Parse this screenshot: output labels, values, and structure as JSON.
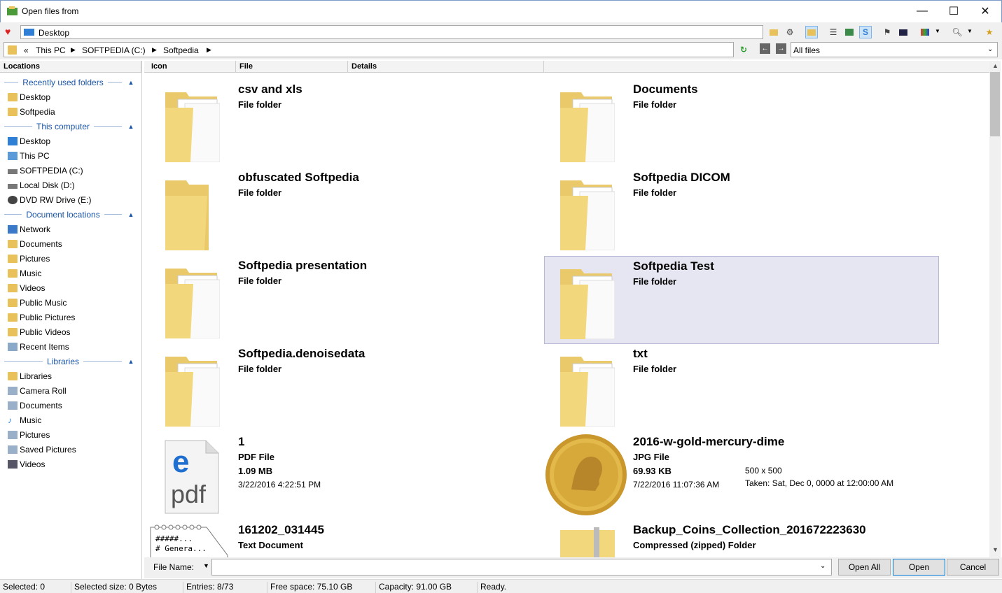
{
  "window": {
    "title": "Open files from",
    "minimize": "—",
    "maximize": "☐",
    "close": "✕"
  },
  "address": {
    "value": "Desktop"
  },
  "breadcrumb": {
    "prefix": "«",
    "parts": [
      "This PC",
      "SOFTPEDIA (C:)",
      "Softpedia"
    ]
  },
  "filter": {
    "value": "All files"
  },
  "columns": {
    "locations": "Locations",
    "icon": "Icon",
    "file": "File",
    "details": "Details"
  },
  "groups": {
    "recent": "Recently used folders",
    "computer": "This computer",
    "documents": "Document locations",
    "libraries": "Libraries"
  },
  "recent_items": [
    "Desktop",
    "Softpedia"
  ],
  "computer_items": [
    "Desktop",
    "This PC",
    "SOFTPEDIA (C:)",
    "Local Disk (D:)",
    "DVD RW Drive (E:)"
  ],
  "document_items": [
    "Network",
    "Documents",
    "Pictures",
    "Music",
    "Videos",
    "Public Music",
    "Public Pictures",
    "Public Videos",
    "Recent Items"
  ],
  "library_items": [
    "Libraries",
    "Camera Roll",
    "Documents",
    "Music",
    "Pictures",
    "Saved Pictures",
    "Videos"
  ],
  "files": [
    {
      "name": "csv and xls",
      "type": "File folder"
    },
    {
      "name": "Documents",
      "type": "File folder"
    },
    {
      "name": "obfuscated Softpedia",
      "type": "File folder"
    },
    {
      "name": "Softpedia DICOM",
      "type": "File folder"
    },
    {
      "name": "Softpedia presentation",
      "type": "File folder"
    },
    {
      "name": "Softpedia Test",
      "type": "File folder"
    },
    {
      "name": "Softpedia.denoisedata",
      "type": "File folder"
    },
    {
      "name": "txt",
      "type": "File folder"
    },
    {
      "name": "1",
      "type": "PDF File",
      "size": "1.09 MB",
      "date": "3/22/2016 4:22:51 PM"
    },
    {
      "name": "2016-w-gold-mercury-dime",
      "type": "JPG File",
      "size": "69.93 KB",
      "date": "7/22/2016 11:07:36 AM",
      "dims": "500 x 500",
      "taken": "Taken: Sat, Dec 0, 0000 at 12:00:00 AM"
    },
    {
      "name": "161202_031445",
      "type": "Text Document"
    },
    {
      "name": "Backup_Coins_Collection_201672223630",
      "type": "Compressed (zipped) Folder"
    }
  ],
  "thumb_text": {
    "pdf": "pdf",
    "txt1": "#####...",
    "txt2": "# Genera..."
  },
  "filename": {
    "label": "File Name:",
    "value": ""
  },
  "buttons": {
    "open_all": "Open All",
    "open": "Open",
    "cancel": "Cancel"
  },
  "status": {
    "selected": "Selected: 0",
    "selected_size": "Selected size: 0 Bytes",
    "entries": "Entries: 8/73",
    "free": "Free space: 75.10 GB",
    "capacity": "Capacity: 91.00 GB",
    "state": "Ready."
  }
}
